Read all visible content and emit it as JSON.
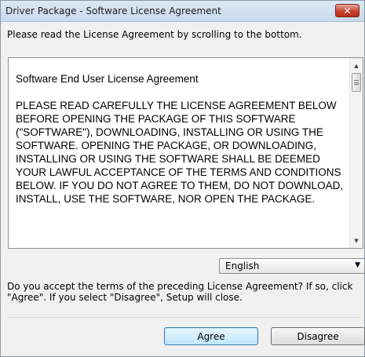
{
  "window": {
    "title": "Driver Package - Software License Agreement",
    "close_glyph": "✕"
  },
  "instruction": "Please read the License Agreement by scrolling to the bottom.",
  "license": {
    "heading": "Software End User License Agreement",
    "body": "PLEASE READ CAREFULLY THE LICENSE AGREEMENT BELOW BEFORE OPENING THE PACKAGE OF THIS SOFTWARE (\"SOFTWARE\"), DOWNLOADING, INSTALLING OR USING THE SOFTWARE. OPENING THE PACKAGE, OR DOWNLOADING, INSTALLING OR USING THE SOFTWARE SHALL BE DEEMED YOUR LAWFUL ACCEPTANCE OF THE TERMS AND CONDITIONS BELOW. IF YOU DO NOT AGREE TO THEM, DO NOT DOWNLOAD, INSTALL, USE THE SOFTWARE, NOR OPEN THE PACKAGE."
  },
  "language": {
    "selected": "English"
  },
  "question": "Do you accept the terms of the preceding License Agreement? If so, click \"Agree\". If you select \"Disagree\", Setup will close.",
  "buttons": {
    "agree": "Agree",
    "disagree": "Disagree"
  },
  "icons": {
    "close": "close-icon",
    "scroll_up": "scroll-up-arrow-icon",
    "scroll_down": "scroll-down-arrow-icon",
    "dropdown": "chevron-down-icon"
  }
}
